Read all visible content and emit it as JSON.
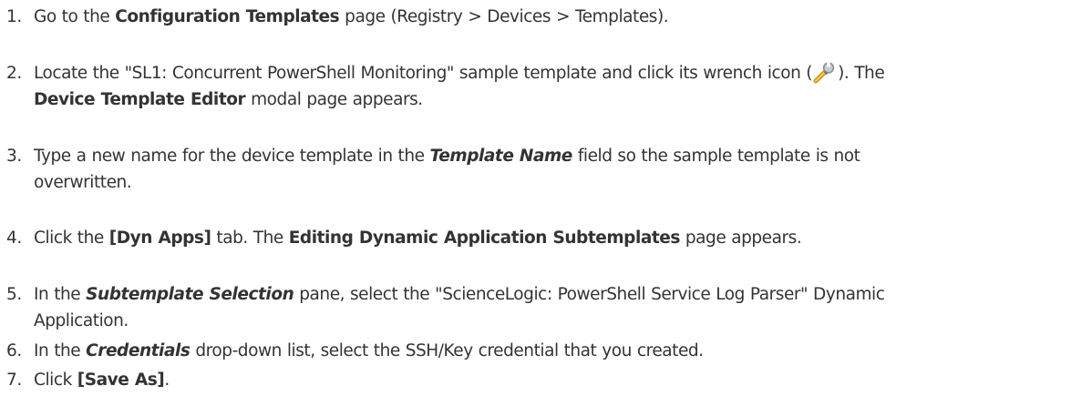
{
  "steps": [
    {
      "number": "1.",
      "parts": [
        {
          "t": "Go to the ",
          "s": "n"
        },
        {
          "t": "Configuration Templates",
          "s": "b"
        },
        {
          "t": " page (Registry > Devices > Templates).",
          "s": "n"
        }
      ]
    },
    {
      "number": "2.",
      "parts": [
        {
          "t": "Locate the \"SL1: Concurrent PowerShell Monitoring\" sample template and click its wrench icon (",
          "s": "n"
        },
        {
          "icon": "wrench-icon"
        },
        {
          "t": "). The",
          "s": "n"
        },
        {
          "br": true
        },
        {
          "t": "Device Template Editor",
          "s": "b"
        },
        {
          "t": " modal page appears.",
          "s": "n"
        }
      ]
    },
    {
      "number": "3.",
      "parts": [
        {
          "t": "Type a new name for the device template in the ",
          "s": "n"
        },
        {
          "t": "Template Name",
          "s": "bi"
        },
        {
          "t": " field so the sample template is not",
          "s": "n"
        },
        {
          "br": true
        },
        {
          "t": "overwritten.",
          "s": "n"
        }
      ]
    },
    {
      "number": "4.",
      "parts": [
        {
          "t": "Click the ",
          "s": "n"
        },
        {
          "t": "[Dyn Apps]",
          "s": "b"
        },
        {
          "t": " tab. The ",
          "s": "n"
        },
        {
          "t": "Editing Dynamic Application Subtemplates",
          "s": "b"
        },
        {
          "t": " page appears.",
          "s": "n"
        }
      ]
    },
    {
      "number": "5.",
      "parts": [
        {
          "t": "In the ",
          "s": "n"
        },
        {
          "t": "Subtemplate Selection",
          "s": "bi"
        },
        {
          "t": " pane, select the \"ScienceLogic: PowerShell Service Log Parser\" Dynamic",
          "s": "n"
        },
        {
          "br": true
        },
        {
          "t": "Application.",
          "s": "n"
        }
      ]
    },
    {
      "number": "6.",
      "parts": [
        {
          "t": "In the ",
          "s": "n"
        },
        {
          "t": "Credentials",
          "s": "bi"
        },
        {
          "t": " drop-down list, select the SSH/Key credential that you created.",
          "s": "n"
        }
      ]
    },
    {
      "number": "7.",
      "parts": [
        {
          "t": "Click ",
          "s": "n"
        },
        {
          "t": "[Save As]",
          "s": "b"
        },
        {
          "t": ".",
          "s": "n"
        }
      ]
    }
  ]
}
